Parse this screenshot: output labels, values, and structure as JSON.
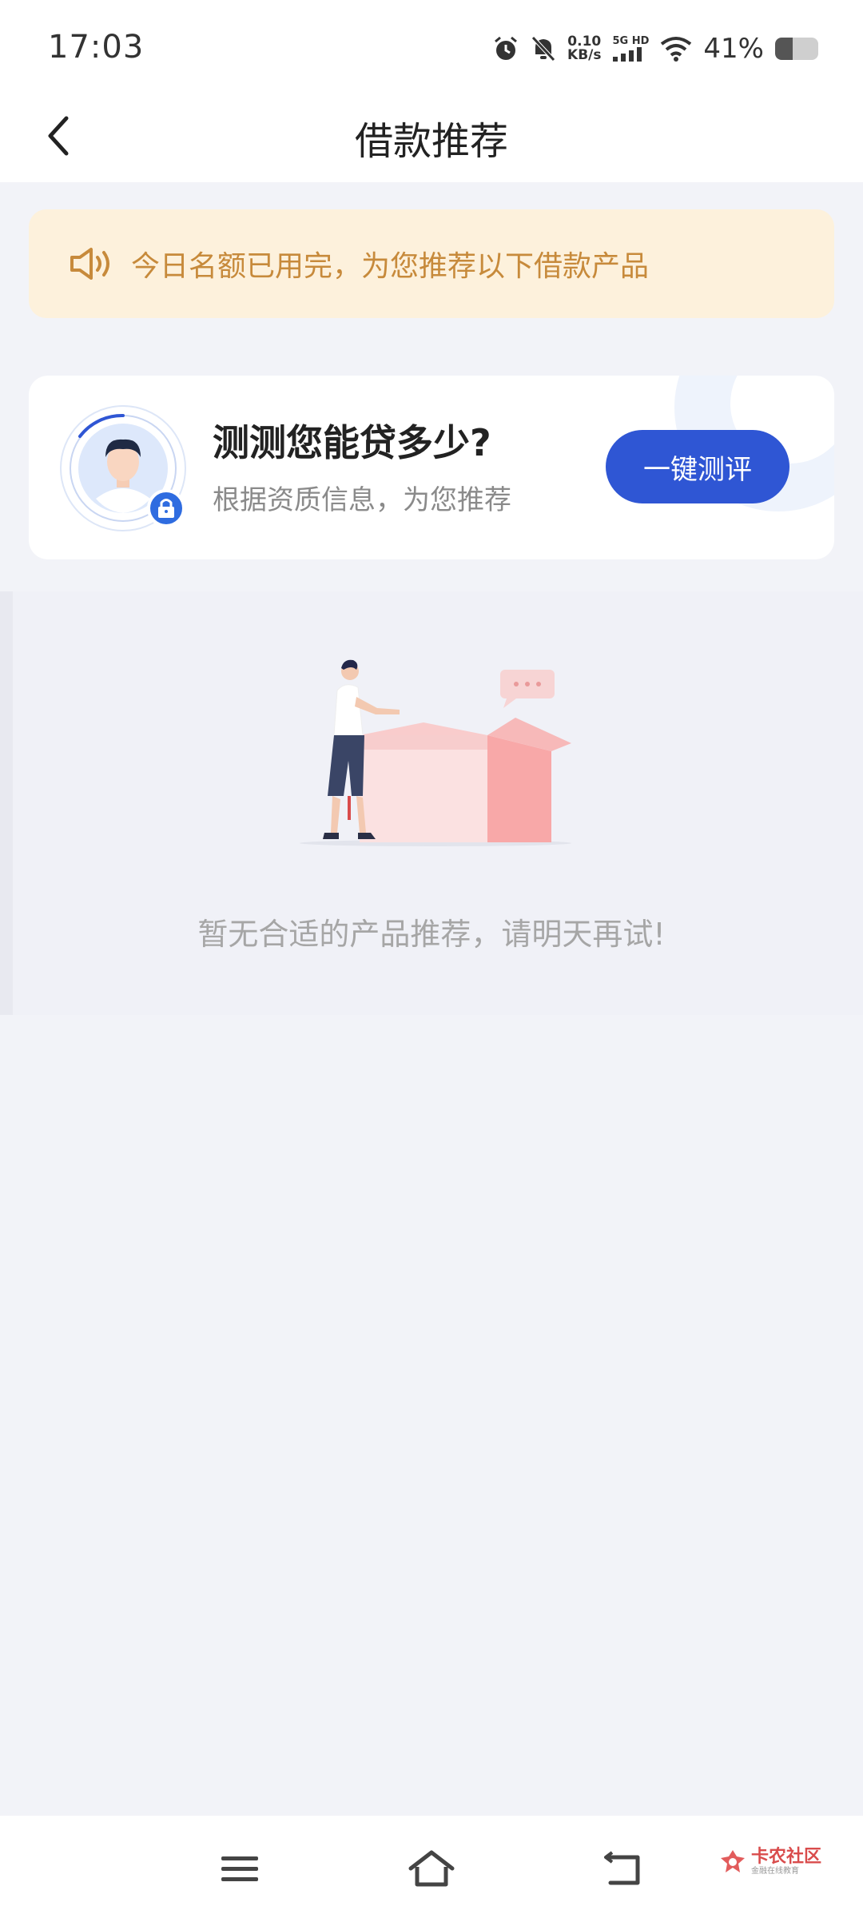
{
  "status_bar": {
    "time": "17:03",
    "net_speed_value": "0.10",
    "net_speed_unit": "KB/s",
    "signal_label": "5G HD",
    "battery_percent": "41%",
    "battery_level": 0.41
  },
  "header": {
    "title": "借款推荐"
  },
  "notice": {
    "text": "今日名额已用完，为您推荐以下借款产品",
    "color": "#c78a3b"
  },
  "assess_card": {
    "title": "测测您能贷多少?",
    "subtitle": "根据资质信息，为您推荐",
    "button_label": "一键测评",
    "button_color": "#2f56d4"
  },
  "empty_state": {
    "message": "暂无合适的产品推荐，请明天再试!"
  },
  "watermark": {
    "main": "卡农社区",
    "sub": "金融在线教育"
  }
}
